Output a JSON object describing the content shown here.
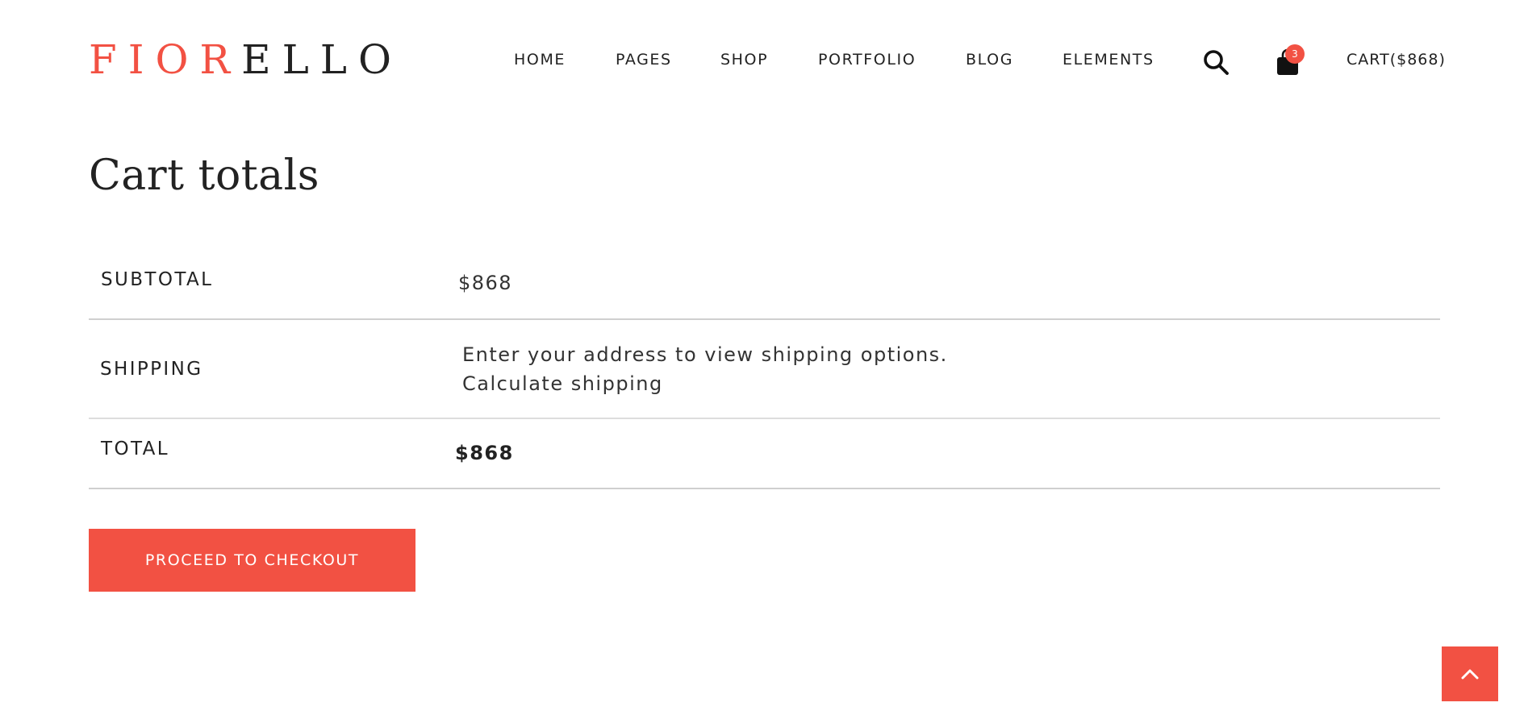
{
  "brand": {
    "logo_part1": "FIOR",
    "logo_part2": "ELLO",
    "accent_color": "#f25143"
  },
  "nav": {
    "items": [
      {
        "label": "HOME"
      },
      {
        "label": "PAGES"
      },
      {
        "label": "SHOP"
      },
      {
        "label": "PORTFOLIO"
      },
      {
        "label": "BLOG"
      },
      {
        "label": "ELEMENTS"
      }
    ],
    "search_icon": "search-icon",
    "cart_icon": "shopping-bag-icon",
    "cart_count": "3",
    "cart_label": "CART($868)"
  },
  "cart_totals": {
    "title": "Cart totals",
    "subtotal_label": "SUBTOTAL",
    "subtotal_value": "$868",
    "shipping_label": "SHIPPING",
    "shipping_text": "Enter your address to view shipping options.",
    "shipping_link": "Calculate shipping",
    "total_label": "TOTAL",
    "total_value": "$868",
    "checkout_button": "PROCEED TO CHECKOUT"
  },
  "back_to_top_icon": "chevron-up-icon"
}
